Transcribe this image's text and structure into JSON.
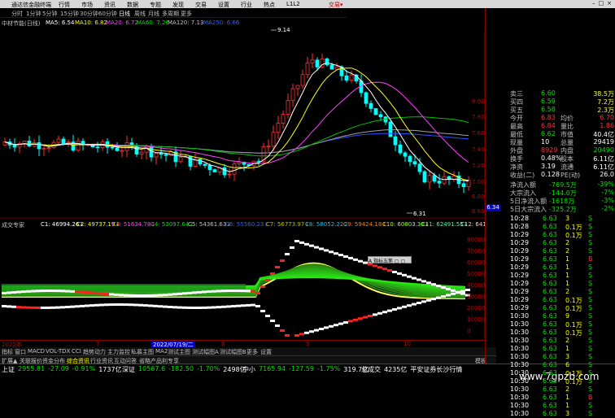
{
  "titlebar": {
    "app_title": "通达信金融终端",
    "menu": [
      "行情",
      "市场",
      "资讯",
      "数据",
      "专题",
      "发现",
      "交易",
      "设置",
      "行业",
      "热点",
      "L1L2"
    ],
    "right_label": "交易▾"
  },
  "periods": [
    "分时",
    "1分钟",
    "5分钟",
    "15分钟",
    "30分钟",
    "60分钟",
    "日线",
    "周线",
    "月线",
    "多周期",
    "更多"
  ],
  "active_period": "日线",
  "ma_bar": {
    "stock": "中材节能(日线)",
    "items": [
      {
        "label": "MA5: 6.54",
        "color": "#ffffff"
      },
      {
        "label": "MA10: 6.82",
        "color": "#ffff00"
      },
      {
        "label": "MA20: 6.72",
        "color": "#ff40ff"
      },
      {
        "label": "MA60: 7.26",
        "color": "#00e000"
      },
      {
        "label": "MA120: 7.13",
        "color": "#c0c0c0"
      },
      {
        "label": "MA250: 6.66",
        "color": "#3060ff"
      }
    ]
  },
  "price_axis": [
    "8.00",
    "7.80",
    "7.60",
    "7.40",
    "7.20",
    "7.00",
    "6.80",
    "6.60"
  ],
  "price_tag": "6.34",
  "annotations": {
    "high": "9.14",
    "low": "6.31"
  },
  "indicator": {
    "name": "成交专家",
    "values": [
      "C1: 46994.26↓",
      "C2: 49737.19↓",
      "C3: 51634.78↓",
      "C4: 53097.64↓",
      "C5: 54361.63↓",
      "C6: 55560.23↓",
      "C7: 56773.97↓",
      "C8: 58052.22↓",
      "C9: 59424.18↓",
      "C10: 60803.30↓",
      "C11: 62491.55↓",
      "C12: 6418"
    ],
    "axis": [
      "80000",
      "70000",
      "60000",
      "50000",
      "40000",
      "30000",
      "20000",
      "10000",
      "0"
    ],
    "popup": "A 指标五笔 ▢ ▢"
  },
  "dates": {
    "start": "2022年",
    "mid_label": "2022/07/19/二",
    "m7": "7",
    "m8": "8",
    "m9": "9",
    "m10": "10"
  },
  "bottom_tabs": [
    "指标",
    "窗口",
    "MACD",
    "VOL-TDX",
    "CCI",
    "趋势动力",
    "主力监控",
    "私募主图",
    "MA2",
    "测试主图",
    "测试幅图A",
    "测试幅图B",
    "更多",
    "设置"
  ],
  "info_bar": [
    "扩展▲",
    "关联报价",
    "资金分布",
    "综合资讯",
    "行业资讯",
    "互动问答",
    "省略产品利专享"
  ],
  "info_right": "模板",
  "quote": {
    "rows": [
      {
        "l": "卖三",
        "v1": "6.60",
        "l2": "",
        "v2": "38.5万",
        "c1": "green",
        "c2": "yellow"
      },
      {
        "l": "买四",
        "v1": "6.59",
        "l2": "",
        "v2": "7.2万",
        "c1": "green",
        "c2": "yellow"
      },
      {
        "l": "买五",
        "v1": "6.58",
        "l2": "",
        "v2": "2.3万",
        "c1": "green",
        "c2": "yellow"
      },
      {
        "l": "今开",
        "v1": "6.83",
        "l2": "均价",
        "v2": "6.70",
        "c1": "red",
        "c2": "red"
      },
      {
        "l": "最高",
        "v1": "6.84",
        "l2": "量比",
        "v2": "1.86",
        "c1": "red",
        "c2": "red"
      },
      {
        "l": "最低",
        "v1": "6.62",
        "l2": "市值",
        "v2": "40.4亿",
        "c1": "green",
        "c2": "white"
      },
      {
        "l": "现量",
        "v1": "10",
        "l2": "总量",
        "v2": "29419",
        "c1": "white",
        "c2": "white"
      },
      {
        "l": "外盘",
        "v1": "8929",
        "l2": "内盘",
        "v2": "20490",
        "c1": "red",
        "c2": "green"
      },
      {
        "l": "换手",
        "v1": "0.48%",
        "l2": "股本",
        "v2": "6.11亿",
        "c1": "white",
        "c2": "white"
      },
      {
        "l": "净资",
        "v1": "3.19",
        "l2": "流通",
        "v2": "6.11亿",
        "c1": "white",
        "c2": "white"
      },
      {
        "l": "收益(二)",
        "v1": "0.128",
        "l2": "PE(动)",
        "v2": "26.0",
        "c1": "white",
        "c2": "white"
      }
    ],
    "flows": [
      {
        "l": "净流入额",
        "v": "-769.5万",
        "p": "-39%"
      },
      {
        "l": "大宗流入",
        "v": "-144.0万",
        "p": "-7%"
      },
      {
        "l": "5日净流入额",
        "v": "-1618万",
        "p": "-3%"
      },
      {
        "l": "5日大宗流入",
        "v": "-325.2万",
        "p": "-2%"
      }
    ]
  },
  "ticks": [
    {
      "t": "10:28",
      "p": "6.63",
      "v": "3",
      "d": "S"
    },
    {
      "t": "10:28",
      "p": "6.63",
      "v": "0.1万",
      "d": "S"
    },
    {
      "t": "10:29",
      "p": "6.63",
      "v": "0.1万",
      "d": "S"
    },
    {
      "t": "10:29",
      "p": "6.63",
      "v": "2",
      "d": "S"
    },
    {
      "t": "10:29",
      "p": "6.63",
      "v": "2",
      "d": "S"
    },
    {
      "t": "10:29",
      "p": "6.63",
      "v": "1",
      "d": "B"
    },
    {
      "t": "10:29",
      "p": "6.63",
      "v": "1",
      "d": "S"
    },
    {
      "t": "10:29",
      "p": "6.63",
      "v": "1",
      "d": "S"
    },
    {
      "t": "10:29",
      "p": "6.63",
      "v": "1",
      "d": "S"
    },
    {
      "t": "10:29",
      "p": "6.63",
      "v": "2",
      "d": "S"
    },
    {
      "t": "10:29",
      "p": "6.63",
      "v": "0.1万",
      "d": "S"
    },
    {
      "t": "10:29",
      "p": "6.63",
      "v": "0.1万",
      "d": "S"
    },
    {
      "t": "10:30",
      "p": "6.63",
      "v": "9",
      "d": "S"
    },
    {
      "t": "10:30",
      "p": "6.63",
      "v": "0.1万",
      "d": "S"
    },
    {
      "t": "10:30",
      "p": "6.63",
      "v": "0.1万",
      "d": "S"
    },
    {
      "t": "10:30",
      "p": "6.63",
      "v": "2",
      "d": "S"
    },
    {
      "t": "10:30",
      "p": "6.63",
      "v": "1",
      "d": "S"
    },
    {
      "t": "10:30",
      "p": "6.63",
      "v": "3",
      "d": "S"
    },
    {
      "t": "10:30",
      "p": "6.63",
      "v": "6",
      "d": "S"
    },
    {
      "t": "10:30",
      "p": "6.63",
      "v": "0.1万",
      "d": "S"
    },
    {
      "t": "10:30",
      "p": "6.63",
      "v": "0.1万",
      "d": "S"
    },
    {
      "t": "10:30",
      "p": "6.63",
      "v": "2",
      "d": "S"
    },
    {
      "t": "10:30",
      "p": "6.63",
      "v": "1",
      "d": "B"
    },
    {
      "t": "10:30",
      "p": "6.63",
      "v": "1",
      "d": "S"
    },
    {
      "t": "10:30",
      "p": "6.63",
      "v": "3",
      "d": "S"
    }
  ],
  "status": [
    {
      "name": "上证",
      "val": "2955.81",
      "chg": "-27.09",
      "pct": "-0.91%",
      "amt": "1737亿"
    },
    {
      "name": "深证",
      "val": "10567.6",
      "chg": "-182.50",
      "pct": "-1.70%",
      "amt": "2498亿"
    },
    {
      "name": "中小",
      "val": "7165.94",
      "chg": "-127.59",
      "pct": "-1.75%",
      "amt": "319.7亿"
    }
  ],
  "status_right": [
    "总成交",
    "4235亿",
    "平安证券长沙行情"
  ],
  "watermark": "www.7gpzb.com"
}
